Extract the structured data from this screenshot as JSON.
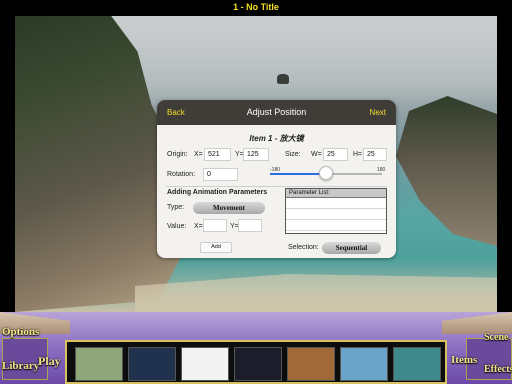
{
  "window": {
    "title": "1 - No Title"
  },
  "dialog": {
    "back_label": "Back",
    "title": "Adjust Position",
    "next_label": "Next",
    "item_title": "Item 1 - 放大镜",
    "origin_label": "Origin:",
    "x_label": "X=",
    "x_value": "521",
    "y_label": "Y=",
    "y_value": "125",
    "size_label": "Size:",
    "w_label": "W=",
    "w_value": "25",
    "h_label": "H=",
    "h_value": "25",
    "rotation_label": "Rotation:",
    "rotation_value": "0",
    "slider_min": "-180",
    "slider_max": "180",
    "slider_value": 0,
    "anim_heading": "Adding Animation Parameters",
    "type_label": "Type:",
    "type_value": "Movement",
    "value_label": "Value:",
    "value_x_label": "X=",
    "value_x": "",
    "value_y_label": "Y=",
    "value_y": "",
    "add_label": "Add",
    "param_list_header": "Parameter List:",
    "selection_label": "Selection:",
    "selection_value": "Sequential"
  },
  "bottombar": {
    "options_label": "Options",
    "library_label": "Library",
    "play_label": "Play",
    "items_label": "Items",
    "scene_label": "Scene",
    "effects_label": "Effects",
    "thumbnails": [
      {
        "name": "thumb-green",
        "color": "#8fa67a"
      },
      {
        "name": "thumb-blue-light",
        "color": "#20324e"
      },
      {
        "name": "thumb-white-book",
        "color": "#f2f2f2"
      },
      {
        "name": "thumb-galaxy",
        "color": "#1b1d2a"
      },
      {
        "name": "thumb-wood-room",
        "color": "#a06a38"
      },
      {
        "name": "thumb-island",
        "color": "#6aa4c8"
      },
      {
        "name": "thumb-beach",
        "color": "#3e8a8a"
      }
    ]
  },
  "colors": {
    "title_yellow": "#f0e020",
    "header_bg": "#403c38",
    "link_yellow": "#f3df2a",
    "bar_purple": "#8e72c4",
    "gold": "#f2e58a"
  }
}
